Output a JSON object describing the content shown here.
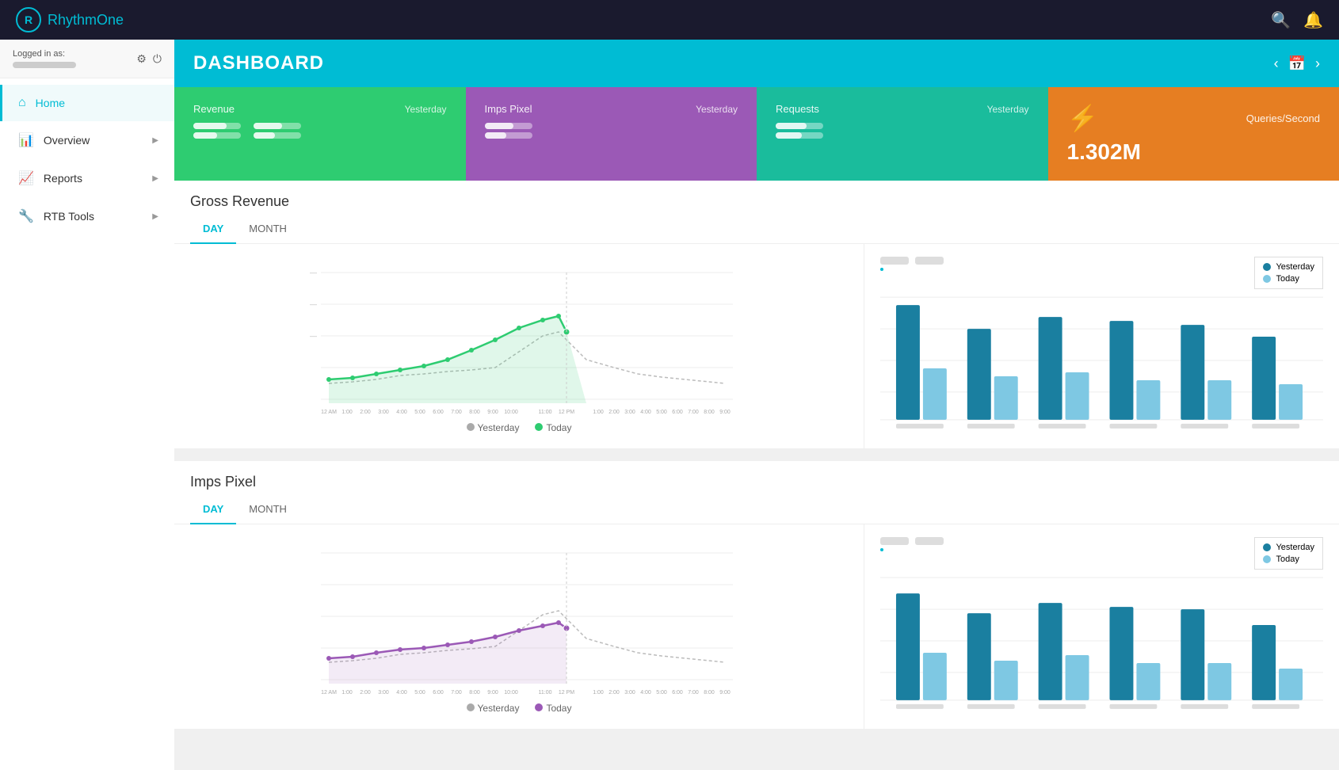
{
  "app": {
    "logo_r": "R",
    "logo_name1": "Rhythm",
    "logo_name2": "One"
  },
  "nav": {
    "search_icon": "🔍",
    "bell_icon": "🔔"
  },
  "sidebar": {
    "logged_in_label": "Logged in as:",
    "items": [
      {
        "id": "home",
        "icon": "⌂",
        "label": "Home",
        "active": true
      },
      {
        "id": "overview",
        "icon": "📊",
        "label": "Overview",
        "active": false,
        "has_arrow": true
      },
      {
        "id": "reports",
        "icon": "📈",
        "label": "Reports",
        "active": false,
        "has_arrow": true
      },
      {
        "id": "rtbtools",
        "icon": "🔧",
        "label": "RTB Tools",
        "active": false,
        "has_arrow": true
      }
    ]
  },
  "header": {
    "title": "DASHBOARD",
    "prev_icon": "‹",
    "calendar_icon": "📅",
    "next_icon": "›"
  },
  "stat_cards": [
    {
      "id": "revenue",
      "color": "green",
      "label": "Revenue",
      "sublabel": "Yesterday",
      "bar1_width": "70",
      "bar2_width": "50"
    },
    {
      "id": "imps_pixel",
      "color": "purple",
      "label": "Imps Pixel",
      "sublabel": "Yesterday",
      "bar1_width": "60",
      "bar2_width": "45"
    },
    {
      "id": "requests",
      "color": "teal",
      "label": "Requests",
      "sublabel": "Yesterday",
      "bar1_width": "65",
      "bar2_width": "55"
    },
    {
      "id": "queries_per_second",
      "color": "orange",
      "label": "Queries/Second",
      "sublabel": "",
      "value": "1.302M"
    }
  ],
  "gross_revenue": {
    "title": "Gross Revenue",
    "tabs": [
      "DAY",
      "MONTH"
    ],
    "active_tab": "DAY",
    "legend": {
      "yesterday_label": "Yesterday",
      "today_label": "Today",
      "yesterday_color": "#aaa",
      "today_color": "#2ecc71"
    },
    "bar_legend": {
      "yesterday_label": "Yesterday",
      "today_label": "Today",
      "yesterday_color": "#1a7fa0",
      "today_color": "#7ec8e3"
    },
    "x_labels": [
      "12 AM",
      "1:00",
      "2:00",
      "3:00",
      "4:00",
      "5:00",
      "6:00",
      "7:00",
      "8:00",
      "9:00",
      "10:00",
      "11:00",
      "12 PM",
      "1:00",
      "2:00",
      "3:00",
      "4:00",
      "5:00",
      "6:00",
      "7:00",
      "8:00",
      "9:00",
      "10:00",
      "11:00"
    ],
    "bar_groups": [
      {
        "dark": 90,
        "light": 35
      },
      {
        "dark": 70,
        "light": 45
      },
      {
        "dark": 80,
        "light": 42
      },
      {
        "dark": 78,
        "light": 38
      },
      {
        "dark": 75,
        "light": 40
      },
      {
        "dark": 65,
        "light": 35
      }
    ],
    "bar_x_labels": [
      "blurred1",
      "blurred2",
      "blurred3",
      "blurred4",
      "blurred5",
      "blurred6"
    ]
  },
  "imps_pixel": {
    "title": "Imps Pixel",
    "tabs": [
      "DAY",
      "MONTH"
    ],
    "active_tab": "DAY",
    "legend": {
      "yesterday_label": "Yesterday",
      "today_label": "Today",
      "yesterday_color": "#aaa",
      "today_color": "#9b59b6"
    },
    "bar_legend": {
      "yesterday_label": "Yesterday",
      "today_label": "Today",
      "yesterday_color": "#1a7fa0",
      "today_color": "#7ec8e3"
    },
    "bar_groups": [
      {
        "dark": 80,
        "light": 32
      },
      {
        "dark": 68,
        "light": 42
      },
      {
        "dark": 75,
        "light": 38
      },
      {
        "dark": 72,
        "light": 36
      },
      {
        "dark": 60,
        "light": 33
      },
      {
        "dark": 50,
        "light": 28
      }
    ]
  }
}
